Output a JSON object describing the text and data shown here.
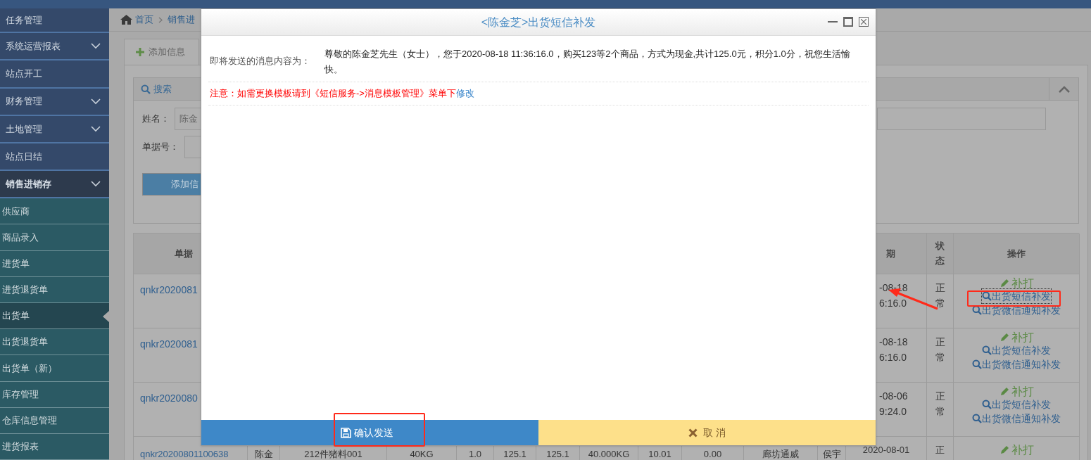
{
  "sidebar": {
    "items": [
      {
        "label": "任务管理",
        "kind": "link"
      },
      {
        "label": "系统运营报表",
        "kind": "group",
        "expanded": false
      },
      {
        "label": "站点开工",
        "kind": "link"
      },
      {
        "label": "财务管理",
        "kind": "group",
        "expanded": false
      },
      {
        "label": "土地管理",
        "kind": "group",
        "expanded": false
      },
      {
        "label": "站点日结",
        "kind": "link"
      },
      {
        "label": "销售进销存",
        "kind": "group",
        "expanded": true,
        "children": [
          {
            "label": "供应商",
            "selected": false
          },
          {
            "label": "商品录入",
            "selected": false
          },
          {
            "label": "进货单",
            "selected": false
          },
          {
            "label": "进货退货单",
            "selected": false
          },
          {
            "label": "出货单",
            "selected": true
          },
          {
            "label": "出货退货单",
            "selected": false
          },
          {
            "label": "出货单（新）",
            "selected": false
          },
          {
            "label": "库存管理",
            "selected": false
          },
          {
            "label": "仓库信息管理",
            "selected": false
          },
          {
            "label": "进货报表",
            "selected": false
          }
        ]
      }
    ]
  },
  "breadcrumb": [
    "首页",
    "销售进"
  ],
  "tab": {
    "label": "添加信息"
  },
  "search": {
    "title": "搜索",
    "fields": [
      {
        "label": "姓名：",
        "value": "陈金"
      },
      {
        "label": "单据号："
      }
    ],
    "button": "添加信"
  },
  "table": {
    "columns": [
      "单据",
      "期",
      "状态",
      "操作"
    ],
    "rows": [
      {
        "kind": "covered",
        "id": "qnkr2020081",
        "date": [
          "-08-18",
          "6:16.0"
        ],
        "status": "正常",
        "actions": [
          {
            "kind": "reprint",
            "label": "补打"
          },
          {
            "kind": "sms",
            "label": "出货短信补发",
            "focused": true
          },
          {
            "kind": "wechat",
            "label": "出货微信通知补发"
          }
        ]
      },
      {
        "kind": "covered",
        "id": "qnkr2020081",
        "date": [
          "-08-18",
          "6:16.0"
        ],
        "status": "正常",
        "actions": [
          {
            "kind": "reprint",
            "label": "补打"
          },
          {
            "kind": "sms",
            "label": "出货短信补发",
            "focused": false
          },
          {
            "kind": "wechat",
            "label": "出货微信通知补发"
          }
        ]
      },
      {
        "kind": "covered",
        "id": "qnkr2020080",
        "date": [
          "-08-06",
          "9:24.0"
        ],
        "status": "正常",
        "actions": [
          {
            "kind": "reprint",
            "label": "补打"
          },
          {
            "kind": "sms",
            "label": "出货短信补发",
            "focused": false
          },
          {
            "kind": "wechat",
            "label": "出货微信通知补发"
          }
        ]
      },
      {
        "kind": "full",
        "id": "qnkr20200801100638",
        "cells": [
          "陈金",
          "212件猪料001",
          "40KG",
          "1.0",
          "125.1",
          "125.1",
          "40.000KG",
          "10.01",
          "0.00",
          "廊坊通威",
          "侯宇"
        ],
        "date": [
          "2020-08-01"
        ],
        "status": "正",
        "actions": [
          {
            "kind": "reprint",
            "label": "补打"
          }
        ]
      }
    ]
  },
  "dialog": {
    "title": "<陈金芝>出货短信补发",
    "content_label": "即将发送的消息内容为：",
    "message": "尊敬的陈金芝先生（女士），您于2020-08-18 11:36:16.0，购买123等2个商品，方式为现金,共计125.0元，积分1.0分，祝您生活愉快。",
    "notice": "注意：如需更换模板请到《短信服务->消息模板管理》菜单下",
    "notice_link": "修改",
    "confirm": "确认发送",
    "cancel": "取 消"
  }
}
